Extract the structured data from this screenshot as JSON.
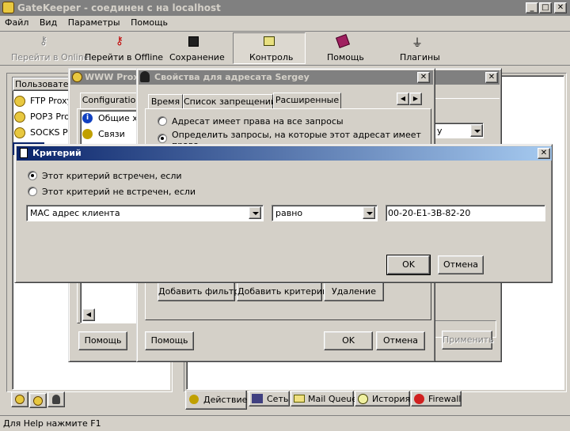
{
  "app": {
    "title": "GateKeeper - соединен с на localhost",
    "menu": [
      "Файл",
      "Вид",
      "Параметры",
      "Помощь"
    ],
    "toolbar": [
      {
        "label": "Перейти в Online",
        "icon": "key-icon",
        "disabled": true
      },
      {
        "label": "Перейти в Offline",
        "icon": "keys-icon",
        "disabled": false
      },
      {
        "label": "Сохранение",
        "icon": "floppy-icon",
        "disabled": false
      },
      {
        "label": "Контроль",
        "icon": "control-icon",
        "disabled": false
      },
      {
        "label": "Помощь",
        "icon": "help-book-icon",
        "disabled": false
      },
      {
        "label": "Плагины",
        "icon": "plug-icon",
        "disabled": false
      }
    ],
    "left_panel": {
      "header": "Пользовател",
      "items": [
        "FTP Proxy",
        "POP3 Pro",
        "SOCKS P"
      ]
    },
    "bottom_tabs": [
      "Действие",
      "Сеть",
      "Mail Queue",
      "История",
      "Firewall"
    ],
    "statusbar": "Для Help нажмите F1"
  },
  "www_proxy": {
    "title": "WWW Prox",
    "tab": "Configuration",
    "items": [
      "Общие х",
      "Связи"
    ],
    "help": "Помощь"
  },
  "props_dialog": {
    "title": "Свойства для адресата Sergey",
    "tabs": [
      "Время",
      "Список запрещений",
      "Расширенные"
    ],
    "radio_all": "Адресат имеет права на все запросы",
    "radio_define": "Определить запросы, на которые этот адресат имеет",
    "radio_define_cut": "права",
    "buttons": {
      "add_filter": "Добавить фильтр",
      "add_criterion": "Добавить критерий",
      "delete": "Удаление",
      "help": "Помощь",
      "ok": "OK",
      "cancel": "Отмена",
      "apply": "Применить"
    }
  },
  "back_dialog": {
    "combo_value": "у"
  },
  "criterion_dialog": {
    "title": "Критерий",
    "radio_met": "Этот критерий встречен, если",
    "radio_not_met": "Этот критерий не встречен, если",
    "field": "MAC адрес клиента",
    "operator": "равно",
    "value": "00-20-E1-3B-82-20",
    "ok": "OK",
    "cancel": "Отмена"
  }
}
